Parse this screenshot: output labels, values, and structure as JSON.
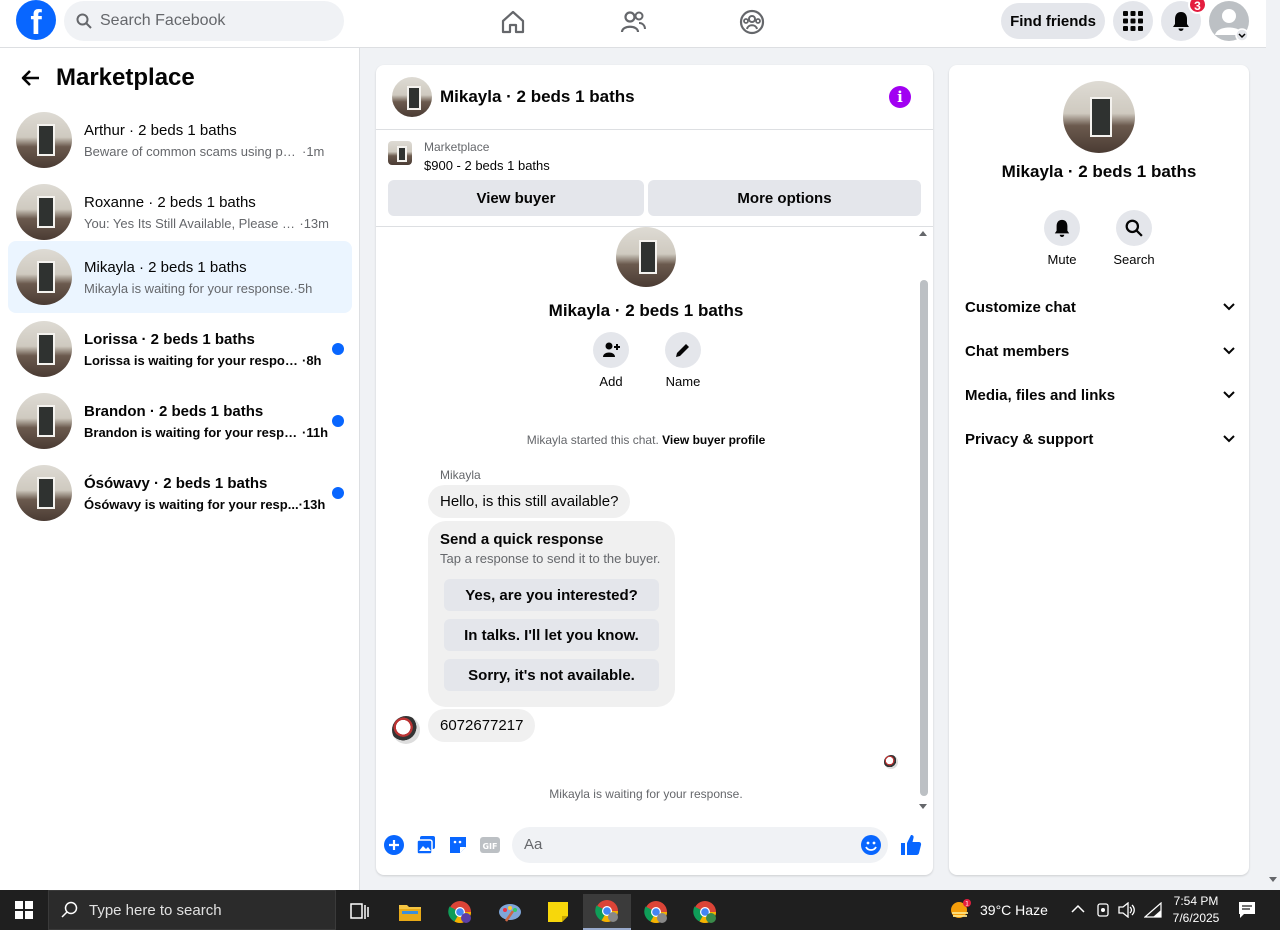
{
  "topbar": {
    "search_placeholder": "Search Facebook",
    "find_friends": "Find friends",
    "notification_count": "3"
  },
  "left": {
    "title": "Marketplace",
    "conversations": [
      {
        "name": "Arthur · 2 beds 1 baths",
        "snippet": "Beware of common scams using pay...",
        "time": "·1m",
        "unread": false
      },
      {
        "name": "Roxanne · 2 beds 1 baths",
        "snippet": "You: Yes Its Still Available, Please Se...",
        "time": "·13m",
        "unread": false
      },
      {
        "name": "Mikayla · 2 beds 1 baths",
        "snippet": "Mikayla is waiting for your response.",
        "time": "·5h",
        "unread": false
      },
      {
        "name": "Lorissa · 2 beds 1 baths",
        "snippet": "Lorissa is waiting for your response.",
        "time": "·8h",
        "unread": true
      },
      {
        "name": "Brandon · 2 beds 1 baths",
        "snippet": "Brandon is waiting for your respo...",
        "time": "·11h",
        "unread": true
      },
      {
        "name": "Ósówavy · 2 beds 1 baths",
        "snippet": "Ósówavy is waiting for your resp...",
        "time": "·13h",
        "unread": true
      }
    ]
  },
  "chat": {
    "title": "Mikayla · 2 beds 1 baths",
    "listing_label": "Marketplace",
    "listing_price": "$900 - 2 beds 1 baths",
    "view_buyer": "View buyer",
    "more_options": "More options",
    "profile_name": "Mikayla · 2 beds 1 baths",
    "add_label": "Add",
    "name_label": "Name",
    "started_text": "Mikayla started this chat.",
    "view_buyer_profile": "View buyer profile",
    "sender": "Mikayla",
    "first_message": "Hello, is this still available?",
    "quick_title": "Send a quick response",
    "quick_sub": "Tap a response to send it to the buyer.",
    "quick_responses": [
      "Yes, are you interested?",
      "In talks. I'll let you know.",
      "Sorry, it's not available."
    ],
    "second_message": "6072677217",
    "waiting": "Mikayla is waiting for your response.",
    "composer_placeholder": "Aa"
  },
  "right": {
    "name": "Mikayla · 2 beds 1 baths",
    "mute": "Mute",
    "search": "Search",
    "sections": [
      "Customize chat",
      "Chat members",
      "Media, files and links",
      "Privacy & support"
    ]
  },
  "taskbar": {
    "search_placeholder": "Type here to search",
    "weather": "39°C  Haze",
    "time": "7:54 PM",
    "date": "7/6/2025"
  },
  "colors": {
    "brand": "#0866ff",
    "unread_dot": "#0866ff",
    "info": "#a100f2",
    "badge": "#e41e3f"
  }
}
